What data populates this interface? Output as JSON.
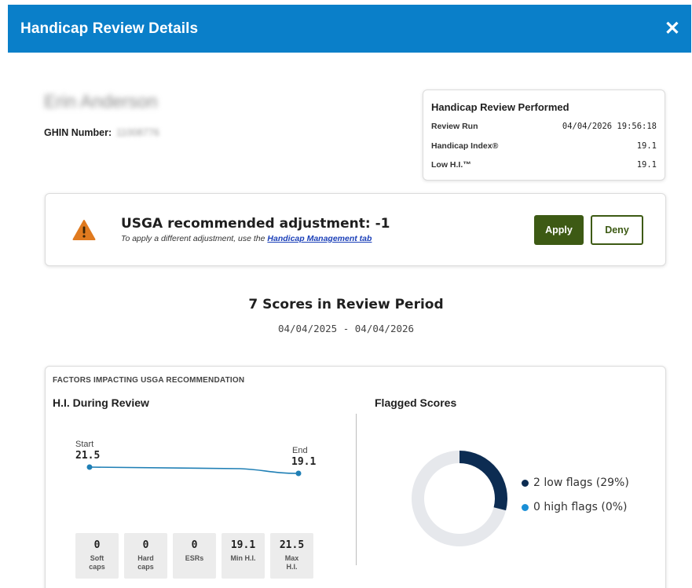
{
  "header": {
    "title": "Handicap Review Details",
    "close_symbol": "✕"
  },
  "golfer": {
    "name": "Erin Anderson",
    "ghin_label": "GHIN Number:",
    "ghin_value": "11008776"
  },
  "review_card": {
    "title": "Handicap Review Performed",
    "rows": [
      {
        "label": "Review Run",
        "value": "04/04/2026 19:56:18"
      },
      {
        "label": "Handicap Index®",
        "value": "19.1"
      },
      {
        "label": "Low H.I.™",
        "value": "19.1"
      }
    ]
  },
  "adjustment": {
    "icon": "warning-triangle-icon",
    "title": "USGA recommended adjustment: -1",
    "subtitle_prefix": "To apply a different adjustment, use the ",
    "subtitle_link": "Handicap Management tab",
    "apply_label": "Apply",
    "deny_label": "Deny"
  },
  "scores": {
    "title": "7 Scores in Review Period",
    "range": "04/04/2025 - 04/04/2026"
  },
  "factors": {
    "heading": "FACTORS IMPACTING USGA RECOMMENDATION",
    "hi_title": "H.I. During Review",
    "flagged_title": "Flagged Scores",
    "stats": [
      {
        "value": "0",
        "label1": "Soft",
        "label2": "caps"
      },
      {
        "value": "0",
        "label1": "Hard",
        "label2": "caps"
      },
      {
        "value": "0",
        "label1": "ESRs",
        "label2": ""
      },
      {
        "value": "19.1",
        "label1": "Min H.I.",
        "label2": ""
      },
      {
        "value": "21.5",
        "label1": "Max",
        "label2": "H.I."
      }
    ]
  },
  "chart_data": [
    {
      "type": "line",
      "x": [
        "Start",
        "End"
      ],
      "series": [
        {
          "values": [
            21.5,
            19.1
          ]
        }
      ],
      "point_labels": {
        "start_label": "Start",
        "start_value": "21.5",
        "end_label": "End",
        "end_value": "19.1"
      },
      "color": "#1f7fb5"
    },
    {
      "type": "pie",
      "categories": [
        "2 low flags (29%)",
        "0 high flags (0%)"
      ],
      "values": [
        29,
        0
      ],
      "colors": {
        "low": "#0c2c52",
        "high": "#1a8fd6",
        "remainder": "#e6e8ec"
      }
    }
  ],
  "colors": {
    "header": "#0a7fc9",
    "primary_button": "#3d5a14",
    "warning": "#e07a1f"
  }
}
